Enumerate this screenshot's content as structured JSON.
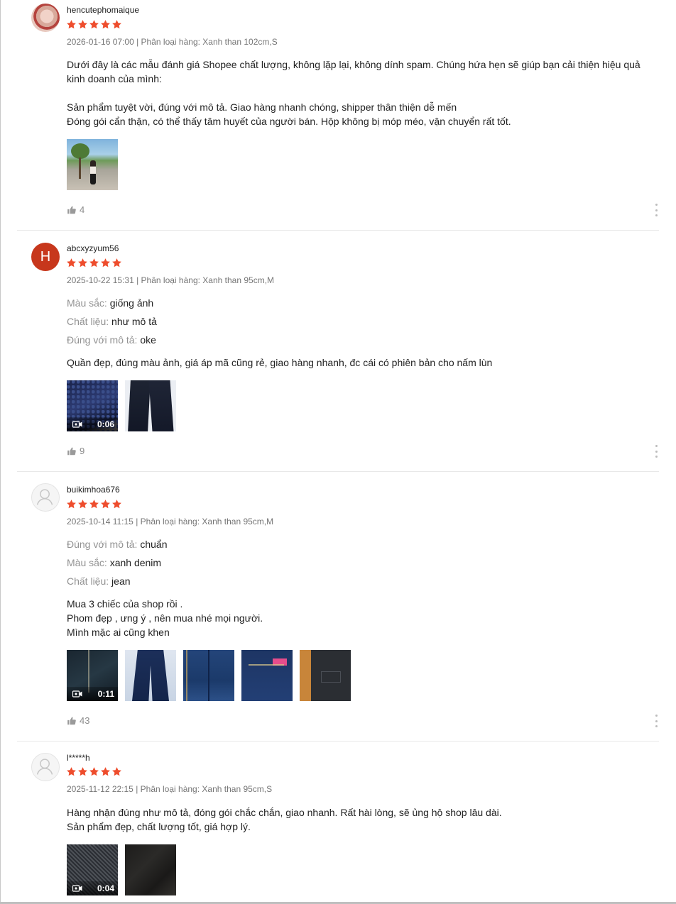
{
  "reviews": [
    {
      "username": "hencutephomaique",
      "avatar": {
        "type": "photo"
      },
      "rating": 5,
      "date": "2026-01-16 07:00",
      "variation_label": "Phân loại hàng:",
      "variation_value": "Xanh than 102cm,S",
      "attributes": [],
      "text_lines": [
        "Dưới đây là các mẫu đánh giá Shopee chất lượng, không lặp lại, không dính spam. Chúng hứa hẹn sẽ giúp bạn cải thiện hiệu quả",
        "kinh doanh của mình:",
        "",
        "Sản phẩm tuyệt vời, đúng với mô tả. Giao hàng nhanh chóng, shipper thân thiện dễ mến",
        "Đóng gói cẩn thận, có thể thấy tâm huyết của người bán. Hộp không bị móp méo, vận chuyển rất tốt."
      ],
      "media": [
        {
          "kind": "photo",
          "icon": "park-photo"
        }
      ],
      "likes": "4"
    },
    {
      "username": "abcxyzyum56",
      "avatar": {
        "type": "letter",
        "letter": "H"
      },
      "rating": 5,
      "date": "2025-10-22 15:31",
      "variation_label": "Phân loại hàng:",
      "variation_value": "Xanh than 95cm,M",
      "attributes": [
        {
          "key": "Màu sắc:",
          "value": "giống ảnh"
        },
        {
          "key": "Chất liệu:",
          "value": "như mô tả"
        },
        {
          "key": "Đúng với mô tả:",
          "value": "oke"
        }
      ],
      "text_lines": [
        "Quần đẹp, đúng màu ảnh, giá áp mã cũng rẻ, giao hàng nhanh, đc cái có phiên bản cho nấm lùn"
      ],
      "media": [
        {
          "kind": "video",
          "duration": "0:06",
          "icon": "video-camera-icon"
        },
        {
          "kind": "photo",
          "icon": "pants-photo"
        }
      ],
      "likes": "9"
    },
    {
      "username": "buikimhoa676",
      "avatar": {
        "type": "default"
      },
      "rating": 5,
      "date": "2025-10-14 11:15",
      "variation_label": "Phân loại hàng:",
      "variation_value": "Xanh than 95cm,M",
      "attributes": [
        {
          "key": "Đúng với mô tả:",
          "value": "chuẩn"
        },
        {
          "key": "Màu sắc:",
          "value": "xanh denim"
        },
        {
          "key": "Chất liệu:",
          "value": "jean"
        }
      ],
      "text_lines": [
        "Mua 3 chiếc của shop rồi .",
        "Phom đẹp , ưng ý , nên mua nhé mọi người.",
        "Mình mặc ai cũng khen"
      ],
      "media": [
        {
          "kind": "video",
          "duration": "0:11",
          "icon": "video-camera-icon"
        },
        {
          "kind": "photo",
          "icon": "pants-photo"
        },
        {
          "kind": "photo",
          "icon": "pants-photo"
        },
        {
          "kind": "photo",
          "icon": "pants-photo"
        },
        {
          "kind": "photo",
          "icon": "pants-photo"
        }
      ],
      "likes": "43"
    },
    {
      "username": "l*****h",
      "avatar": {
        "type": "default"
      },
      "rating": 5,
      "date": "2025-11-12 22:15",
      "variation_label": "Phân loại hàng:",
      "variation_value": "Xanh than 95cm,S",
      "attributes": [],
      "text_lines": [
        "Hàng nhận đúng như mô tả, đóng gói chắc chắn, giao nhanh. Rất hài lòng, sẽ ủng hộ shop lâu dài.",
        "Sản phẩm đẹp, chất lượng tốt, giá hợp lý."
      ],
      "media": [
        {
          "kind": "video",
          "duration": "0:04",
          "icon": "video-camera-icon"
        },
        {
          "kind": "photo",
          "icon": "fabric-photo"
        }
      ],
      "likes": ""
    }
  ],
  "colors": {
    "star": "#ee4d2d",
    "avatar_letter_bg": "#c7371c",
    "muted_text": "#757575",
    "attr_key": "#929292"
  },
  "icons": {
    "like": "thumbs-up-icon",
    "more": "more-vertical-icon",
    "star": "star-icon",
    "default_avatar": "user-silhouette-icon"
  }
}
